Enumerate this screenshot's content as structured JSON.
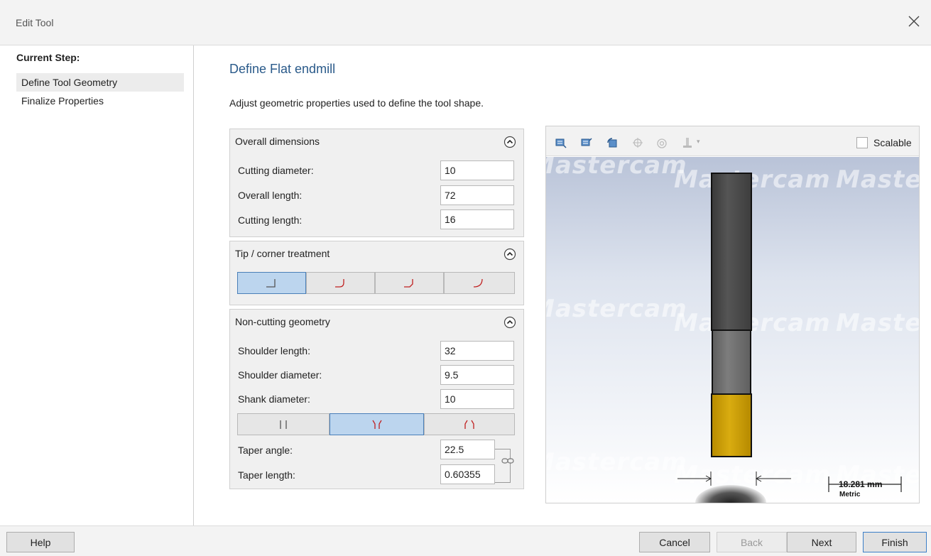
{
  "window": {
    "title": "Edit Tool"
  },
  "sidebar": {
    "heading": "Current Step:",
    "steps": [
      {
        "label": "Define Tool Geometry",
        "active": true
      },
      {
        "label": "Finalize Properties",
        "active": false
      }
    ]
  },
  "main": {
    "title": "Define Flat endmill",
    "description": "Adjust geometric properties used to define the tool shape."
  },
  "overall": {
    "heading": "Overall dimensions",
    "cutting_diameter_label": "Cutting diameter:",
    "cutting_diameter": "10",
    "overall_length_label": "Overall length:",
    "overall_length": "72",
    "cutting_length_label": "Cutting length:",
    "cutting_length": "16"
  },
  "tip": {
    "heading": "Tip / corner treatment",
    "options": [
      "flat",
      "corner-radius",
      "chamfer",
      "full-radius"
    ],
    "selected": 0
  },
  "noncutting": {
    "heading": "Non-cutting geometry",
    "shoulder_length_label": "Shoulder length:",
    "shoulder_length": "32",
    "shoulder_diameter_label": "Shoulder diameter:",
    "shoulder_diameter": "9.5",
    "shank_diameter_label": "Shank diameter:",
    "shank_diameter": "10",
    "taper_options": [
      "straight",
      "taper-in",
      "taper-out"
    ],
    "taper_selected": 1,
    "taper_angle_label": "Taper angle:",
    "taper_angle": "22.5",
    "taper_length_label": "Taper length:",
    "taper_length": "0.60355"
  },
  "preview": {
    "scalable_label": "Scalable",
    "watermark": "Mastercam",
    "scale_value": "18.281 mm",
    "scale_unit": "Metric",
    "colors": {
      "shank": "#4a4a4a",
      "shoulder": "#6f6f6f",
      "flute": "#d4a400"
    }
  },
  "footer": {
    "help": "Help",
    "cancel": "Cancel",
    "back": "Back",
    "next": "Next",
    "finish": "Finish"
  }
}
